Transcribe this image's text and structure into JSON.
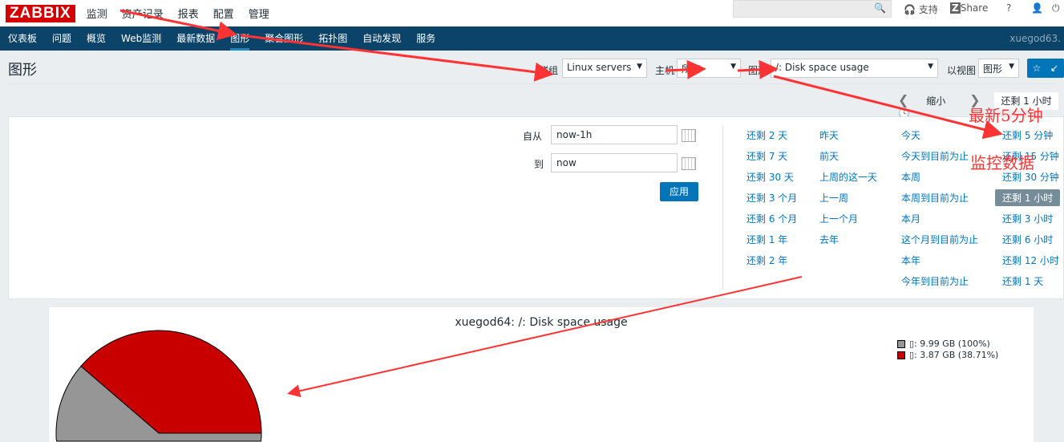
{
  "logo": "ZABBIX",
  "top_menu": [
    "监测",
    "资产记录",
    "报表",
    "配置",
    "管理"
  ],
  "top_right": {
    "support": "支持",
    "share": "Share",
    "help": "?"
  },
  "nav": {
    "items": [
      "仪表板",
      "问题",
      "概览",
      "Web监测",
      "最新数据",
      "图形",
      "聚合图形",
      "拓扑图",
      "自动发现",
      "服务"
    ],
    "active": 5,
    "user": "xuegod63."
  },
  "page": {
    "title": "图形",
    "group_label": "群组",
    "group_value": "Linux servers",
    "host_label": "主机",
    "host_value": "所有",
    "graph_label": "图形",
    "graph_value": "/: Disk space usage",
    "view_label": "以视图",
    "view_value": "图形"
  },
  "timebar": {
    "zoom_out": "缩小",
    "current": "还剩 1 小时"
  },
  "filter": {
    "from_label": "自从",
    "from_value": "now-1h",
    "to_label": "到",
    "to_value": "now",
    "apply": "应用"
  },
  "quick": [
    [
      "还剩 2 天",
      "还剩 7 天",
      "还剩 30 天",
      "还剩 3 个月",
      "还剩 6 个月",
      "还剩 1 年",
      "还剩 2 年"
    ],
    [
      "昨天",
      "前天",
      "上周的这一天",
      "上一周",
      "上一个月",
      "去年"
    ],
    [
      "今天",
      "今天到目前为止",
      "本周",
      "本周到目前为止",
      "本月",
      "这个月到目前为止",
      "本年",
      "今年到目前为止"
    ],
    [
      "还剩 5 分钟",
      "还剩 15 分钟",
      "还剩 30 分钟",
      "还剩 1 小时",
      "还剩 3 小时",
      "还剩 6 小时",
      "还剩 12 小时",
      "还剩 1 天"
    ]
  ],
  "quick_selected": "还剩 1 小时",
  "annotations": {
    "a1": "最新5分钟",
    "a2": "监控数据"
  },
  "chart_data": {
    "type": "pie",
    "title": "xuegod64: /: Disk space usage",
    "series": [
      {
        "name": "▯: 9.99 GB (100%)",
        "label": "▯: 9.99 GB (100%)",
        "value": 61.29,
        "color": "#969696"
      },
      {
        "name": "▯: 3.87 GB (38.71%)",
        "label": "▯: 3.87 GB (38.71%)",
        "value": 38.71,
        "color": "#c80000"
      }
    ],
    "legend": "top-right"
  }
}
